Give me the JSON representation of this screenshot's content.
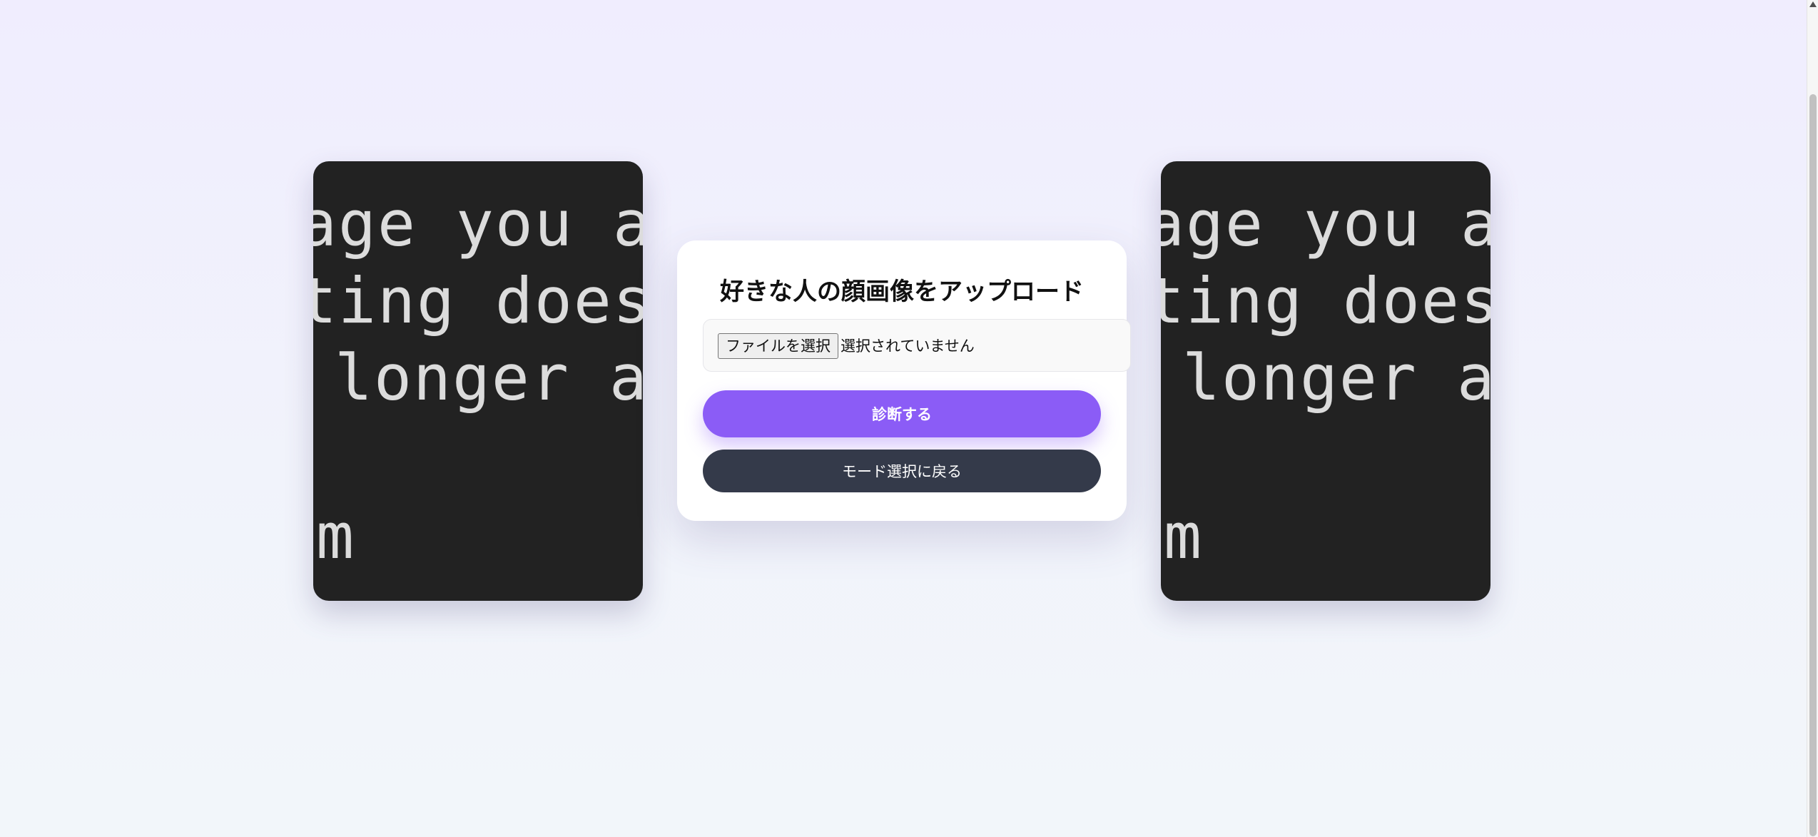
{
  "colors": {
    "primary_button": "#8b5cf6",
    "secondary_button": "#343a4a",
    "placeholder_image_bg": "#222222"
  },
  "side_images": {
    "left": {
      "lines": [
        "age you are",
        "ting does n",
        "longer ava",
        "m"
      ]
    },
    "right": {
      "lines": [
        "age you are",
        "ting does n",
        "longer ava",
        "m"
      ]
    }
  },
  "upload": {
    "title": "好きな人の顔画像をアップロード",
    "file_button_label": "ファイルを選択",
    "file_status": "選択されていません"
  },
  "actions": {
    "diagnose_label": "診断する",
    "back_label": "モード選択に戻る"
  }
}
